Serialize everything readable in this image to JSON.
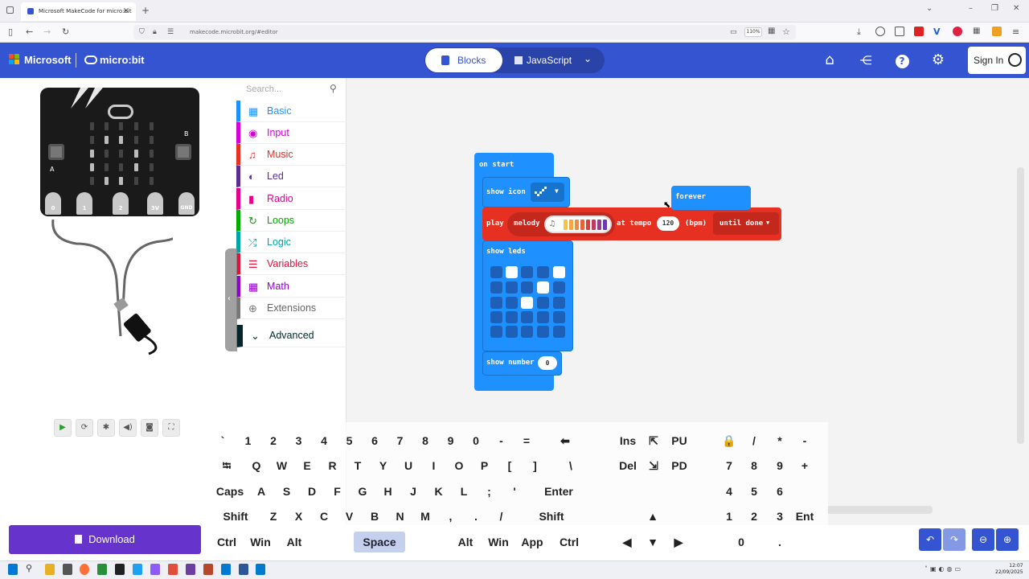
{
  "browser": {
    "tab_title": "Microsoft MakeCode for micro:bit",
    "url": "makecode.microbit.org/#editor",
    "zoom": "110%",
    "new_tab_label": "+",
    "close_tab_label": "×"
  },
  "header": {
    "brand": "Microsoft",
    "product": "micro:bit",
    "blocks_label": "Blocks",
    "javascript_label": "JavaScript",
    "sign_in_label": "Sign In"
  },
  "simulator": {
    "pins": [
      "0",
      "1",
      "2",
      "3V",
      "GND"
    ],
    "button_a": "A",
    "button_b": "B",
    "led_rows": [
      [
        0,
        0,
        0,
        0,
        0
      ],
      [
        0,
        1,
        1,
        0,
        0
      ],
      [
        1,
        0,
        0,
        1,
        0
      ],
      [
        1,
        0,
        0,
        1,
        0
      ],
      [
        0,
        1,
        1,
        0,
        0
      ]
    ]
  },
  "download_label": "Download",
  "toolbox": {
    "search_placeholder": "Search...",
    "categories": [
      {
        "label": "Basic",
        "color": "#1e90ff"
      },
      {
        "label": "Input",
        "color": "#d400d4"
      },
      {
        "label": "Music",
        "color": "#e63022"
      },
      {
        "label": "Led",
        "color": "#5c2d91"
      },
      {
        "label": "Radio",
        "color": "#e3008c"
      },
      {
        "label": "Loops",
        "color": "#00aa00"
      },
      {
        "label": "Logic",
        "color": "#00a4a6"
      },
      {
        "label": "Variables",
        "color": "#dc143c"
      },
      {
        "label": "Math",
        "color": "#9400d3"
      },
      {
        "label": "Extensions",
        "color": "#777777"
      },
      {
        "label": "Advanced",
        "color": "#00272b"
      }
    ]
  },
  "blocks": {
    "on_start": "on start",
    "show_icon": "show icon",
    "play": "play",
    "melody": "melody",
    "at_tempo": "at tempo",
    "tempo_value": "120",
    "bpm": "(bpm)",
    "until_done": "until done",
    "show_leds": "show leds",
    "show_number": "show number",
    "number_value": "0",
    "forever": "forever",
    "leds": [
      [
        0,
        1,
        0,
        0,
        1
      ],
      [
        0,
        0,
        0,
        1,
        0
      ],
      [
        0,
        0,
        1,
        0,
        0
      ],
      [
        0,
        0,
        0,
        0,
        0
      ],
      [
        0,
        0,
        0,
        0,
        0
      ]
    ]
  },
  "keyboard": {
    "rows": [
      [
        "`",
        "1",
        "2",
        "3",
        "4",
        "5",
        "6",
        "7",
        "8",
        "9",
        "0",
        "-",
        "=",
        "⬅"
      ],
      [
        "⭾",
        "Q",
        "W",
        "E",
        "R",
        "T",
        "Y",
        "U",
        "I",
        "O",
        "P",
        "[",
        "]",
        "\\"
      ],
      [
        "Caps",
        "A",
        "S",
        "D",
        "F",
        "G",
        "H",
        "J",
        "K",
        "L",
        ";",
        "'",
        "Enter"
      ],
      [
        "Shift",
        "Z",
        "X",
        "C",
        "V",
        "B",
        "N",
        "M",
        ",",
        ".",
        "/",
        "Shift"
      ],
      [
        "Ctrl",
        "Win",
        "Alt",
        "Space",
        "Alt",
        "Win",
        "App",
        "Ctrl"
      ]
    ],
    "nav": [
      "Ins",
      "⇱",
      "PU",
      "Del",
      "⇲",
      "PD",
      "▲",
      "◀",
      "▼",
      "▶"
    ],
    "numpad": [
      "🔒",
      "/",
      "*",
      "-",
      "7",
      "8",
      "9",
      "+",
      "4",
      "5",
      "6",
      "1",
      "2",
      "3",
      "Ent",
      "0",
      "."
    ]
  },
  "taskbar": {
    "time": "12:07",
    "date": "22/09/2025"
  },
  "colors": {
    "makecode_blue": "#3454d1",
    "basic_block": "#1e90ff",
    "music_block": "#e63022",
    "download_purple": "#6633cc"
  }
}
